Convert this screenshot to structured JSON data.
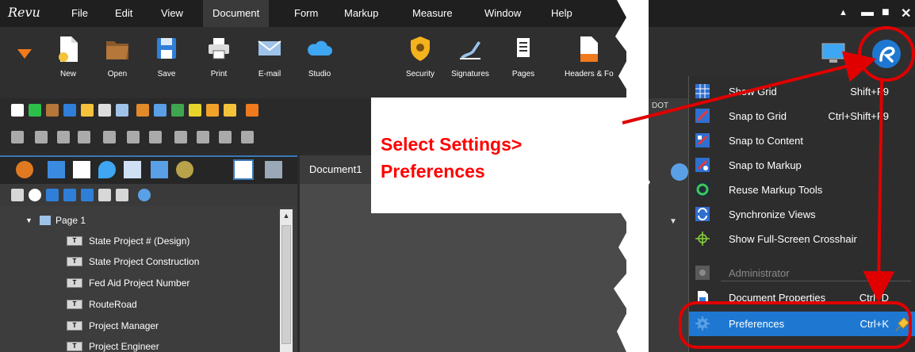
{
  "colors": {
    "accent": "#1e78d2",
    "callout_red": "#ff0000",
    "menu_bg": "#1f1f1f",
    "panel_bg": "#2b2b2b"
  },
  "menubar": {
    "logo": "Revu",
    "items": [
      "File",
      "Edit",
      "View",
      "Document",
      "Form",
      "Markup",
      "Measure",
      "Window",
      "Help"
    ],
    "active": "Document"
  },
  "ribbon": {
    "buttons": [
      {
        "label": "New",
        "icon": "new-document-icon"
      },
      {
        "label": "Open",
        "icon": "folder-open-icon"
      },
      {
        "label": "Save",
        "icon": "save-disk-icon"
      },
      {
        "label": "Print",
        "icon": "printer-icon"
      },
      {
        "label": "E-mail",
        "icon": "envelope-icon"
      },
      {
        "label": "Studio",
        "icon": "studio-cloud-icon"
      },
      {
        "label": "Security",
        "icon": "shield-icon"
      },
      {
        "label": "Signatures",
        "icon": "signature-pen-icon"
      },
      {
        "label": "Pages",
        "icon": "pages-icon"
      },
      {
        "label": "Headers & Fo",
        "icon": "headers-footers-icon"
      }
    ]
  },
  "document_tab": {
    "label": "Document1"
  },
  "tree": {
    "page_label": "Page 1",
    "items": [
      "State Project # (Design)",
      "State Project  Construction",
      "Fed Aid Project Number",
      "RouteRoad",
      "Project Manager",
      "Project Engineer"
    ]
  },
  "callout": {
    "line1": "Select Settings>",
    "line2": "Preferences"
  },
  "right_peek": {
    "fragment": "DOT"
  },
  "settings_menu": {
    "items": [
      {
        "label": "Show Grid",
        "shortcut": "Shift+F9",
        "icon": "grid-icon",
        "state": "normal"
      },
      {
        "label": "Snap to Grid",
        "shortcut": "Ctrl+Shift+F9",
        "icon": "snap-grid-icon",
        "state": "normal"
      },
      {
        "label": "Snap to Content",
        "shortcut": "",
        "icon": "snap-content-icon",
        "state": "normal"
      },
      {
        "label": "Snap to Markup",
        "shortcut": "",
        "icon": "snap-markup-icon",
        "state": "normal"
      },
      {
        "label": "Reuse Markup Tools",
        "shortcut": "",
        "icon": "reuse-tools-icon",
        "state": "normal"
      },
      {
        "label": "Synchronize Views",
        "shortcut": "",
        "icon": "sync-views-icon",
        "state": "normal"
      },
      {
        "label": "Show Full-Screen Crosshair",
        "shortcut": "",
        "icon": "crosshair-icon",
        "state": "normal"
      },
      {
        "label": "Administrator",
        "shortcut": "",
        "icon": "administrator-icon",
        "state": "disabled"
      },
      {
        "label": "Document Properties",
        "shortcut": "Ctrl+D",
        "icon": "document-properties-icon",
        "state": "normal"
      },
      {
        "label": "Preferences",
        "shortcut": "Ctrl+K",
        "icon": "gear-icon",
        "state": "highlighted"
      }
    ]
  }
}
